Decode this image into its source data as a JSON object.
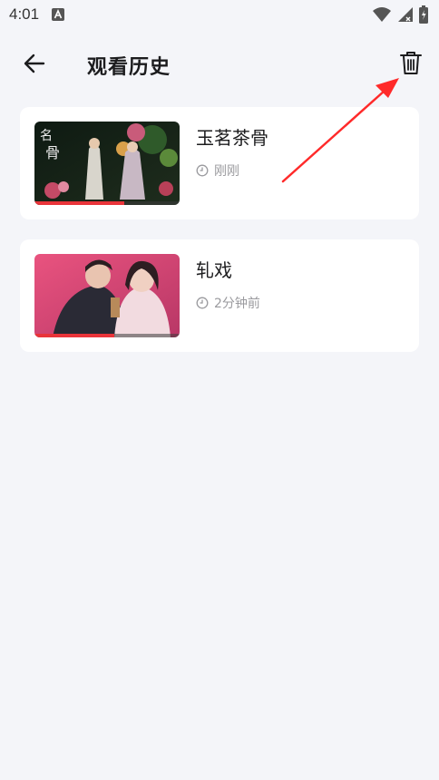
{
  "status_bar": {
    "time": "4:01",
    "notification_icon": "font-a-icon",
    "icons": [
      "wifi-icon",
      "signal-icon",
      "battery-icon"
    ]
  },
  "app_bar": {
    "back_icon": "arrow-left-icon",
    "title": "观看历史",
    "delete_icon": "trash-icon"
  },
  "history": [
    {
      "title": "玉茗茶骨",
      "time": "刚刚",
      "progress": 0.62,
      "thumb": "costume-drama-poster"
    },
    {
      "title": "轧戏",
      "time": "2分钟前",
      "progress": 0.55,
      "thumb": "romance-poster"
    }
  ],
  "colors": {
    "background": "#f4f5f9",
    "card": "#ffffff",
    "progress": "#e9343a",
    "annotation": "#ff2a2a"
  }
}
